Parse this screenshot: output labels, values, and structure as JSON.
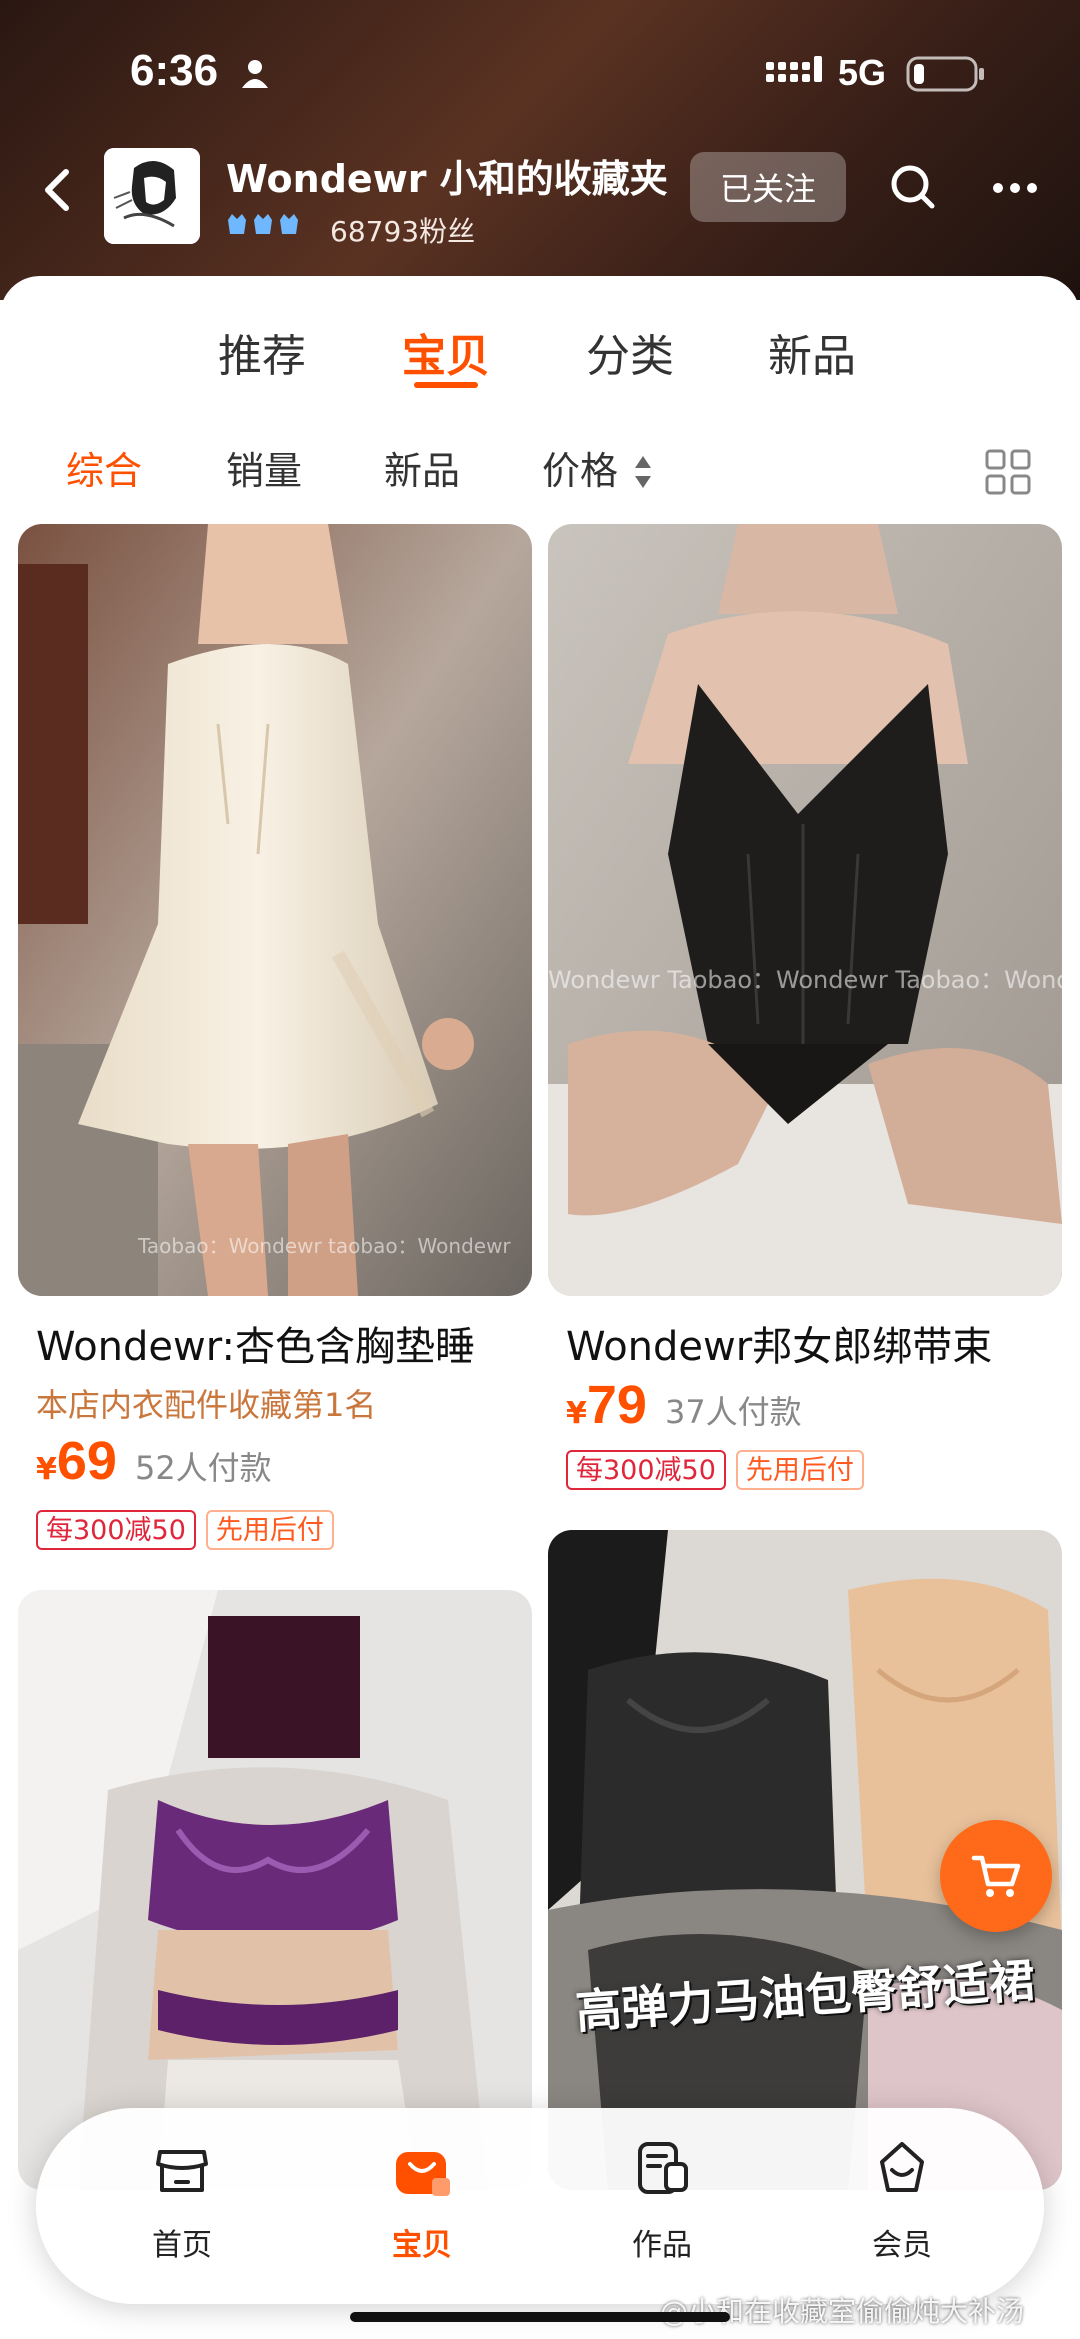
{
  "status_bar": {
    "time": "6:36",
    "network": "5G"
  },
  "store": {
    "name": "Wondewr 小和的收藏夹",
    "fans": "68793粉丝",
    "follow_label": "已关注"
  },
  "tabs": [
    {
      "label": "推荐",
      "active": false
    },
    {
      "label": "宝贝",
      "active": true
    },
    {
      "label": "分类",
      "active": false
    },
    {
      "label": "新品",
      "active": false
    }
  ],
  "sort": [
    {
      "label": "综合",
      "active": true
    },
    {
      "label": "销量",
      "active": false
    },
    {
      "label": "新品",
      "active": false
    },
    {
      "label": "价格",
      "active": false
    }
  ],
  "products": [
    {
      "title": "Wondewr:杏色含胸垫睡",
      "subtitle": "本店内衣配件收藏第1名",
      "currency": "¥",
      "price": "69",
      "sold": "52人付款",
      "tags": [
        "每300减50",
        "先用后付"
      ],
      "watermark": "Taobao：Wondewr taobao：Wondewr"
    },
    {
      "title": "Wondewr邦女郎绑带束",
      "currency": "¥",
      "price": "79",
      "sold": "37人付款",
      "tags": [
        "每300减50",
        "先用后付"
      ],
      "watermark": "Wondewr Taobao：Wondewr Taobao：Wonde"
    },
    {
      "title": ""
    },
    {
      "title": "",
      "overlay_text": "高弹力马油包臀舒适裙"
    }
  ],
  "bottom_nav": [
    {
      "label": "首页",
      "icon": "storefront-icon",
      "active": false
    },
    {
      "label": "宝贝",
      "icon": "shopping-bag-icon",
      "active": true
    },
    {
      "label": "作品",
      "icon": "works-icon",
      "active": false
    },
    {
      "label": "会员",
      "icon": "member-basket-icon",
      "active": false
    }
  ],
  "footer_watermark": "@小和在收藏室偷偷炖大补汤",
  "colors": {
    "accent": "#ff5000",
    "tag_red": "#e0263b",
    "subtitle": "#c9773c"
  }
}
